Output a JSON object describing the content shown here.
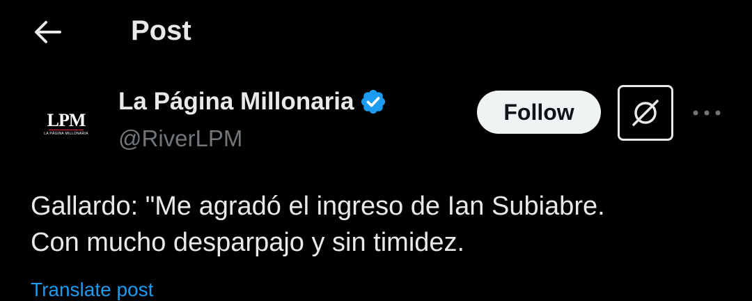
{
  "header": {
    "title": "Post",
    "back_icon": "arrow-left-icon"
  },
  "author": {
    "avatar_text": "LPM",
    "avatar_subtext": "LA PÁGINA MILLONARIA",
    "display_name": "La Página Millonaria",
    "verified_icon": "verified-badge-icon",
    "handle": "@RiverLPM"
  },
  "actions": {
    "follow_label": "Follow",
    "grok_icon": "grok-icon",
    "more_icon": "more-options-icon"
  },
  "post": {
    "text_lines": [
      "Gallardo: \"Me agradó el ingreso de Ian Subiabre.",
      "Con mucho desparpajo y sin timidez."
    ],
    "translate_label": "Translate post"
  },
  "colors": {
    "background": "#000000",
    "text": "#e7e9ea",
    "secondary_text": "#71767b",
    "accent": "#1d9bf0",
    "follow_bg": "#eff3f4"
  }
}
